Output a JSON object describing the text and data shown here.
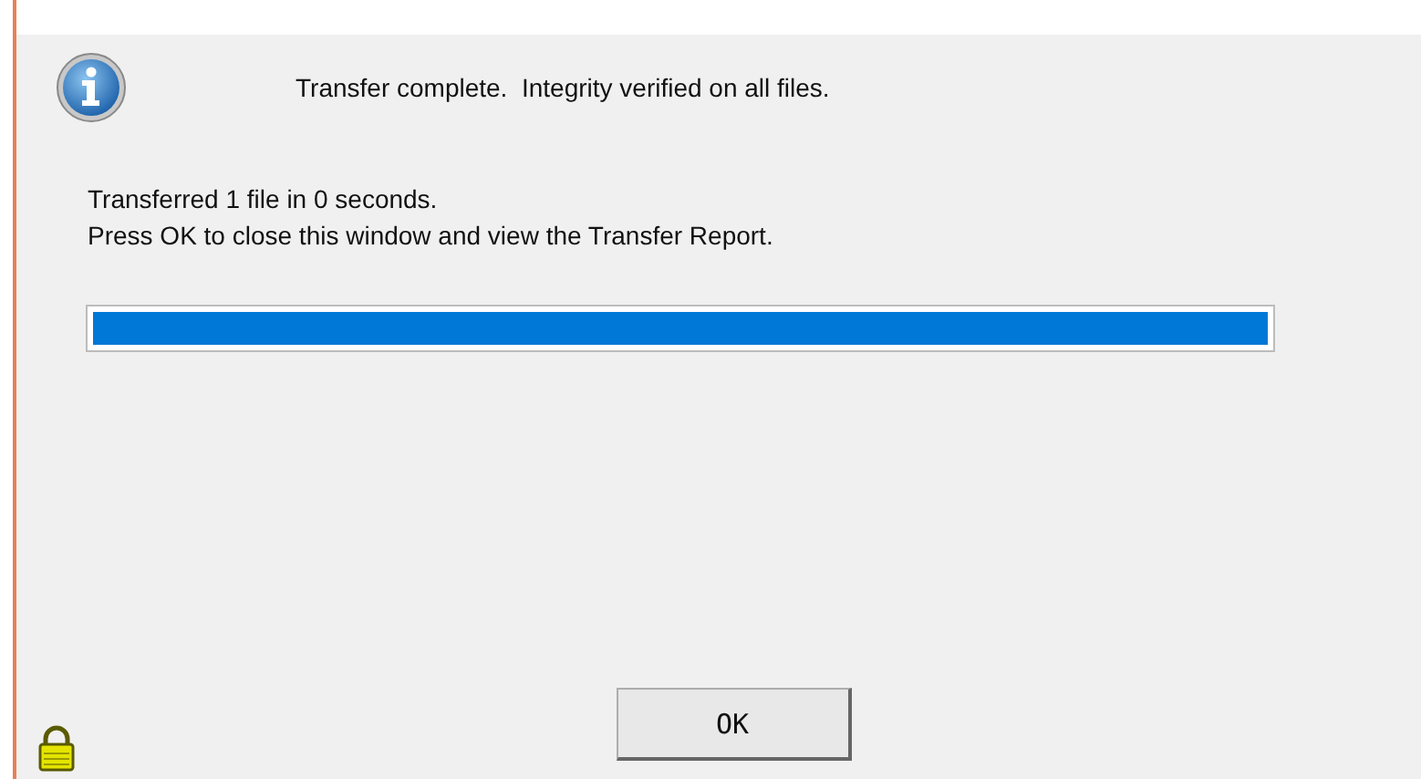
{
  "message": "Transfer complete.  Integrity verified on all files.",
  "details": [
    "Transferred 1 file in 0 seconds.",
    "Press OK to close this window and view the Transfer Report."
  ],
  "progress": {
    "level": 1
  },
  "buttons": [
    "OK"
  ]
}
